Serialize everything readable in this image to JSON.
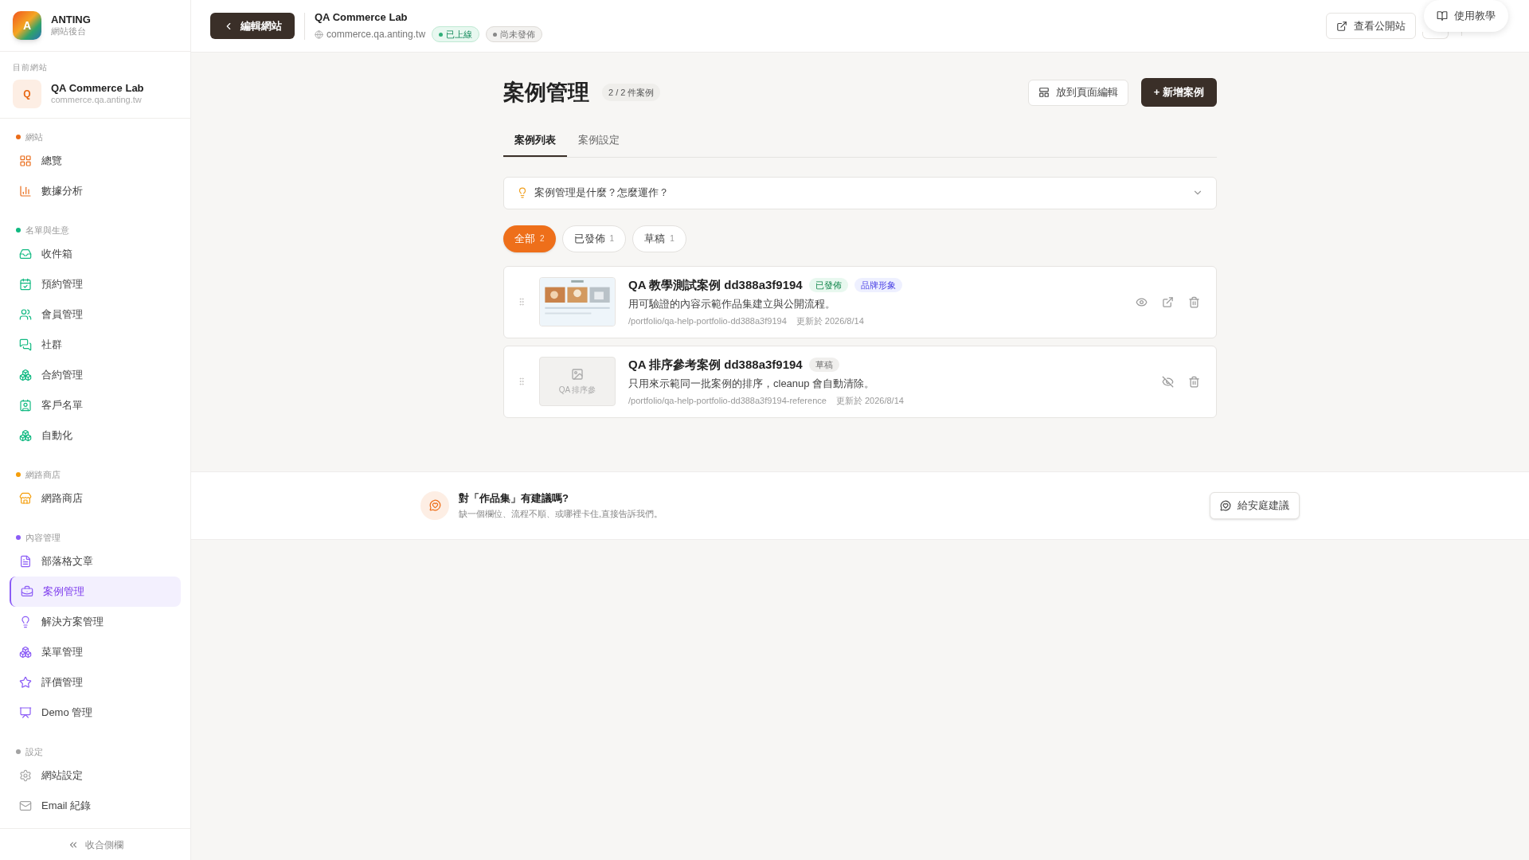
{
  "brand": {
    "logo": "A",
    "name": "ANTING",
    "subtitle": "網站後台"
  },
  "current_site": {
    "label": "目前網站",
    "avatar": "Q",
    "name": "QA Commerce Lab",
    "domain": "commerce.qa.anting.tw"
  },
  "sidebar": {
    "sections": [
      {
        "title": "網站",
        "color": "#ea6c1a",
        "items": [
          {
            "label": "總覽",
            "selected": false
          },
          {
            "label": "數據分析",
            "selected": false
          }
        ]
      },
      {
        "title": "名單與生意",
        "color": "#10b981",
        "items": [
          {
            "label": "收件箱",
            "selected": false
          },
          {
            "label": "預約管理",
            "selected": false
          },
          {
            "label": "會員管理",
            "selected": false
          },
          {
            "label": "社群",
            "selected": false
          },
          {
            "label": "合約管理",
            "selected": false
          },
          {
            "label": "客戶名單",
            "selected": false
          },
          {
            "label": "自動化",
            "selected": false
          }
        ]
      },
      {
        "title": "網路商店",
        "color": "#f59e0b",
        "items": [
          {
            "label": "網路商店",
            "selected": false
          }
        ]
      },
      {
        "title": "內容管理",
        "color": "#8b5cf6",
        "items": [
          {
            "label": "部落格文章",
            "selected": false
          },
          {
            "label": "案例管理",
            "selected": true
          },
          {
            "label": "解決方案管理",
            "selected": false
          },
          {
            "label": "菜單管理",
            "selected": false
          },
          {
            "label": "評價管理",
            "selected": false
          },
          {
            "label": "Demo 管理",
            "selected": false
          }
        ]
      },
      {
        "title": "設定",
        "color": "#a3a3a3",
        "items": [
          {
            "label": "網站設定",
            "selected": false
          },
          {
            "label": "Email 紀錄",
            "selected": false
          }
        ]
      }
    ],
    "collapse": "收合側欄"
  },
  "header": {
    "back_button": "編輯網站",
    "site_name": "QA Commerce Lab",
    "domain": "commerce.qa.anting.tw",
    "badges": [
      {
        "label": "已上線",
        "kind": "live"
      },
      {
        "label": "尚未發佈",
        "kind": "pending"
      }
    ],
    "view_button": "查看公開站",
    "help_button": "使用教學"
  },
  "page": {
    "title": "案例管理",
    "count": "2 / 2 件案例",
    "page_edit_button": "放到頁面編輯",
    "new_button": "+ 新增案例",
    "tabs": [
      {
        "label": "案例列表",
        "selected": true
      },
      {
        "label": "案例設定",
        "selected": false
      }
    ],
    "help": {
      "question": "案例管理是什麼？怎麼運作？",
      "expanded": false
    },
    "filters": [
      {
        "label": "全部",
        "count": "2",
        "selected": true
      },
      {
        "label": "已發佈",
        "count": "1",
        "selected": false
      },
      {
        "label": "草稿",
        "count": "1",
        "selected": false
      }
    ],
    "cases": [
      {
        "title": "QA 教學測試案例 dd388a3f9194",
        "status": {
          "label": "已發佈",
          "kind": "published"
        },
        "tag": "品牌形象",
        "description": "用可驗證的內容示範作品集建立與公開流程。",
        "path": "/portfolio/qa-help-portfolio-dd388a3f9194",
        "updated": "更新於 2026/8/14",
        "visible": true
      },
      {
        "title": "QA 排序參考案例 dd388a3f9194",
        "thumbnail": {
          "kind": "placeholder",
          "label": "QA 排序參"
        },
        "status": {
          "label": "草稿",
          "kind": "draft"
        },
        "description": "只用來示範同一批案例的排序，cleanup 會自動清除。",
        "path": "/portfolio/qa-help-portfolio-dd388a3f9194-reference",
        "updated": "更新於 2026/8/14",
        "visible": false
      }
    ]
  },
  "feedback": {
    "title": "對「作品集」有建議嗎?",
    "subtitle": "缺一個欄位、流程不順、或哪裡卡住,直接告訴我們。",
    "button": "給安庭建議"
  }
}
